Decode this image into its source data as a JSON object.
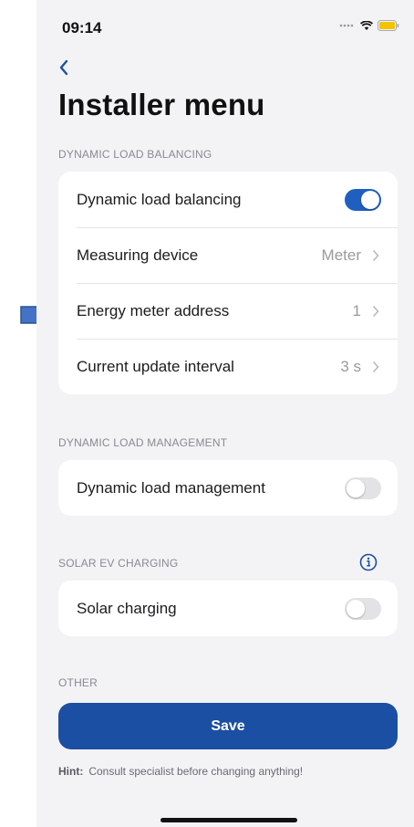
{
  "status_bar": {
    "time": "09:14"
  },
  "title": "Installer menu",
  "sections": {
    "dlb": {
      "header": "DYNAMIC LOAD BALANCING",
      "toggle_label": "Dynamic load balancing",
      "toggle_on": true,
      "measuring_label": "Measuring device",
      "measuring_value": "Meter",
      "meter_address_label": "Energy meter address",
      "meter_address_value": "1",
      "update_interval_label": "Current update interval",
      "update_interval_value": "3 s"
    },
    "dlm": {
      "header": "DYNAMIC LOAD MANAGEMENT",
      "toggle_label": "Dynamic load management",
      "toggle_on": false
    },
    "solar": {
      "header": "SOLAR EV CHARGING",
      "toggle_label": "Solar charging",
      "toggle_on": false
    },
    "other": {
      "header": "OTHER"
    }
  },
  "save_label": "Save",
  "hint": {
    "label": "Hint:",
    "text": "Consult specialist before changing anything!"
  },
  "colors": {
    "accent": "#1b4fa3",
    "toggle_on": "#1f5fbf",
    "arrow_fill": "#4472c4"
  }
}
